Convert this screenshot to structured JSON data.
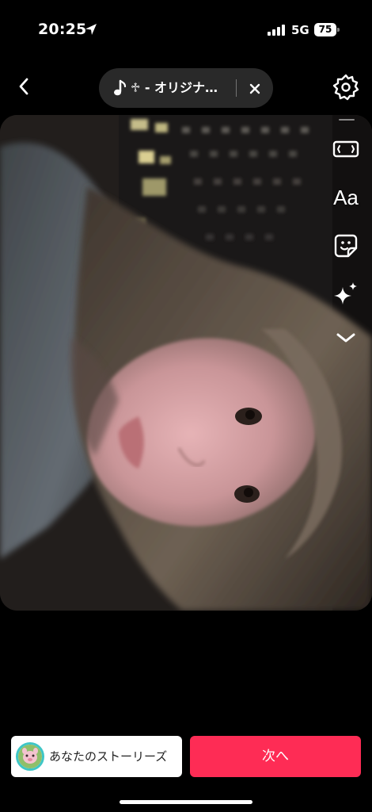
{
  "status_bar": {
    "time": "20:25",
    "network": "5G",
    "battery": "75"
  },
  "top_bar": {
    "sound_title": "♱ - オリジナ…",
    "icons": [
      "back-chevron-icon",
      "music-note-icon",
      "close-icon",
      "gear-icon"
    ]
  },
  "tools": {
    "text_label": "Aa",
    "icons": [
      "aspect-ratio-icon",
      "text-icon",
      "sticker-icon",
      "sparkle-effects-icon",
      "chevron-down-icon"
    ]
  },
  "bottom_bar": {
    "story_label": "あなたのストーリーズ",
    "next_label": "次へ",
    "colors": {
      "next_bg": "#fe2c55",
      "story_ring": "#3ec6c6"
    }
  }
}
